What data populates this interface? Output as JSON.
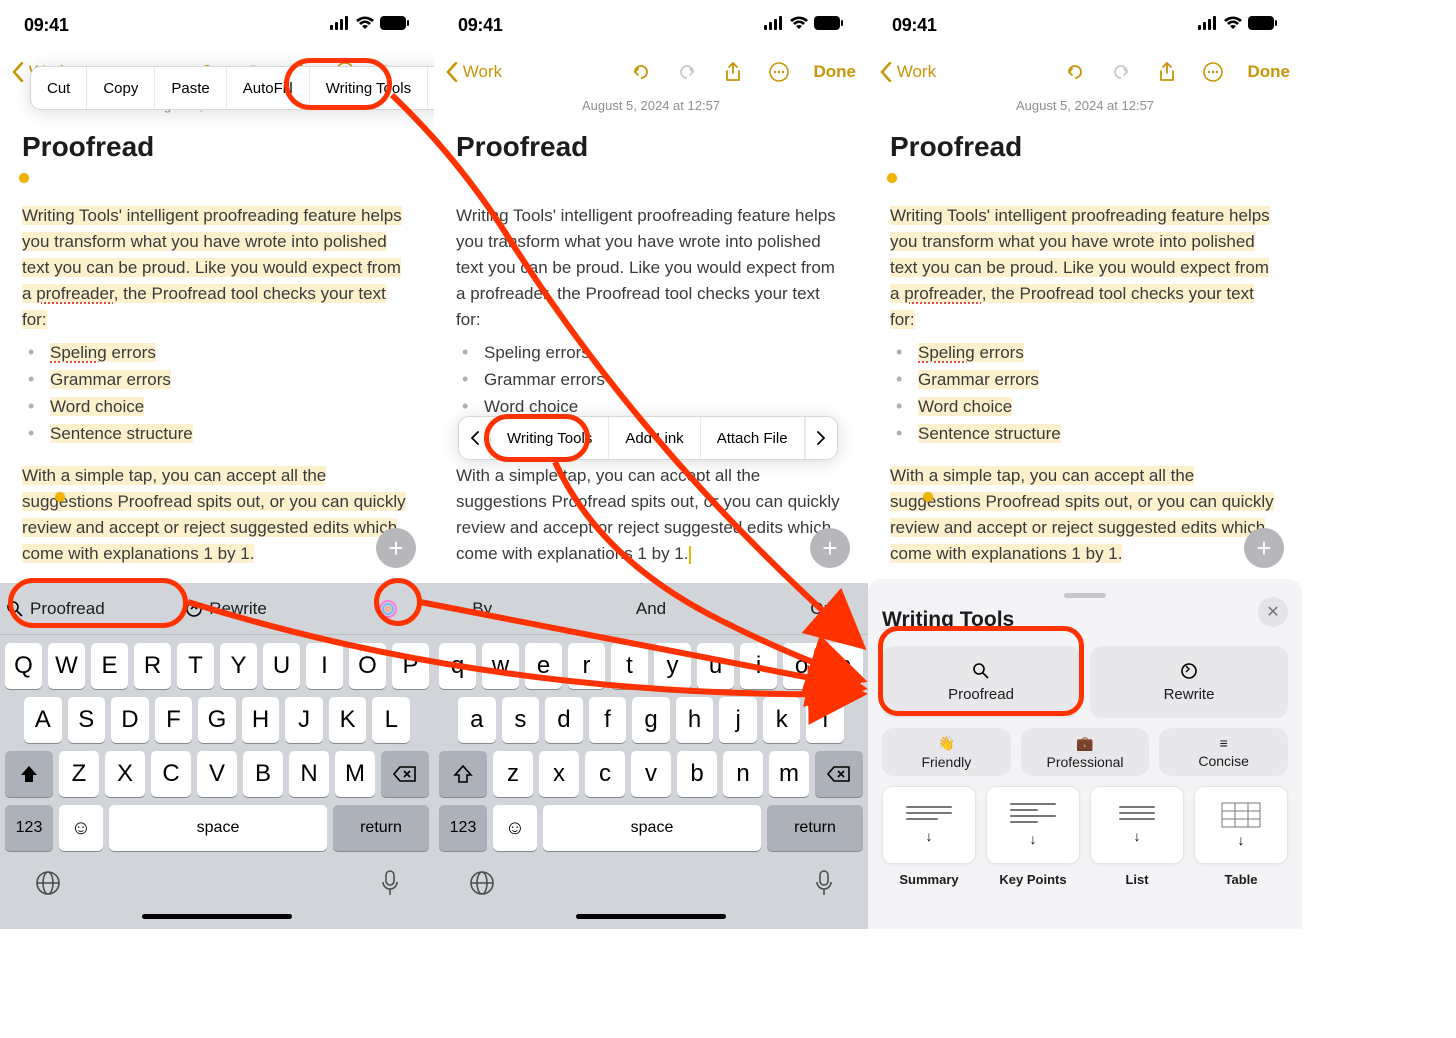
{
  "status": {
    "time": "09:41"
  },
  "nav": {
    "back": "Work",
    "done": "Done"
  },
  "date": "August 5, 2024 at 12:57",
  "title": "Proofread",
  "para1": "Writing Tools' intelligent proofreading feature helps you transform what you have wrote into polished text you can be proud. Like you would expect from a ",
  "err1": "profreader",
  "para1b": ", the Proofread tool checks your text for:",
  "list": {
    "a": "Speling",
    "aRest": " errors",
    "b": "Grammar errors",
    "c": "Word choice",
    "d": "Sentence structure"
  },
  "para2": "With a simple tap, you can accept all the suggestions Proofread spits out, or you can quickly review and accept or reject suggested edits which come with explanations 1 by 1.",
  "popover1": {
    "a": "Cut",
    "b": "Copy",
    "c": "Paste",
    "d": "AutoFill",
    "e": "Writing Tools"
  },
  "popover2": {
    "a": "Writing Tools",
    "b": "Add Link",
    "c": "Attach File"
  },
  "sugg1": {
    "a": "Proofread",
    "b": "Rewrite"
  },
  "sugg2": {
    "a": "By",
    "b": "And",
    "c": "Or"
  },
  "keys_upper": {
    "r1": [
      "Q",
      "W",
      "E",
      "R",
      "T",
      "Y",
      "U",
      "I",
      "O",
      "P"
    ],
    "r2": [
      "A",
      "S",
      "D",
      "F",
      "G",
      "H",
      "J",
      "K",
      "L"
    ],
    "r3": [
      "Z",
      "X",
      "C",
      "V",
      "B",
      "N",
      "M"
    ]
  },
  "keys_lower": {
    "r1": [
      "q",
      "w",
      "e",
      "r",
      "t",
      "y",
      "u",
      "i",
      "o",
      "p"
    ],
    "r2": [
      "a",
      "s",
      "d",
      "f",
      "g",
      "h",
      "j",
      "k",
      "l"
    ],
    "r3": [
      "z",
      "x",
      "c",
      "v",
      "b",
      "n",
      "m"
    ]
  },
  "kbd": {
    "k123": "123",
    "space": "space",
    "ret": "return"
  },
  "sheet": {
    "title": "Writing Tools",
    "big": {
      "a": "Proofread",
      "b": "Rewrite"
    },
    "sm": {
      "a": "Friendly",
      "b": "Professional",
      "c": "Concise"
    },
    "cards": {
      "a": "Summary",
      "b": "Key Points",
      "c": "List",
      "d": "Table"
    }
  }
}
